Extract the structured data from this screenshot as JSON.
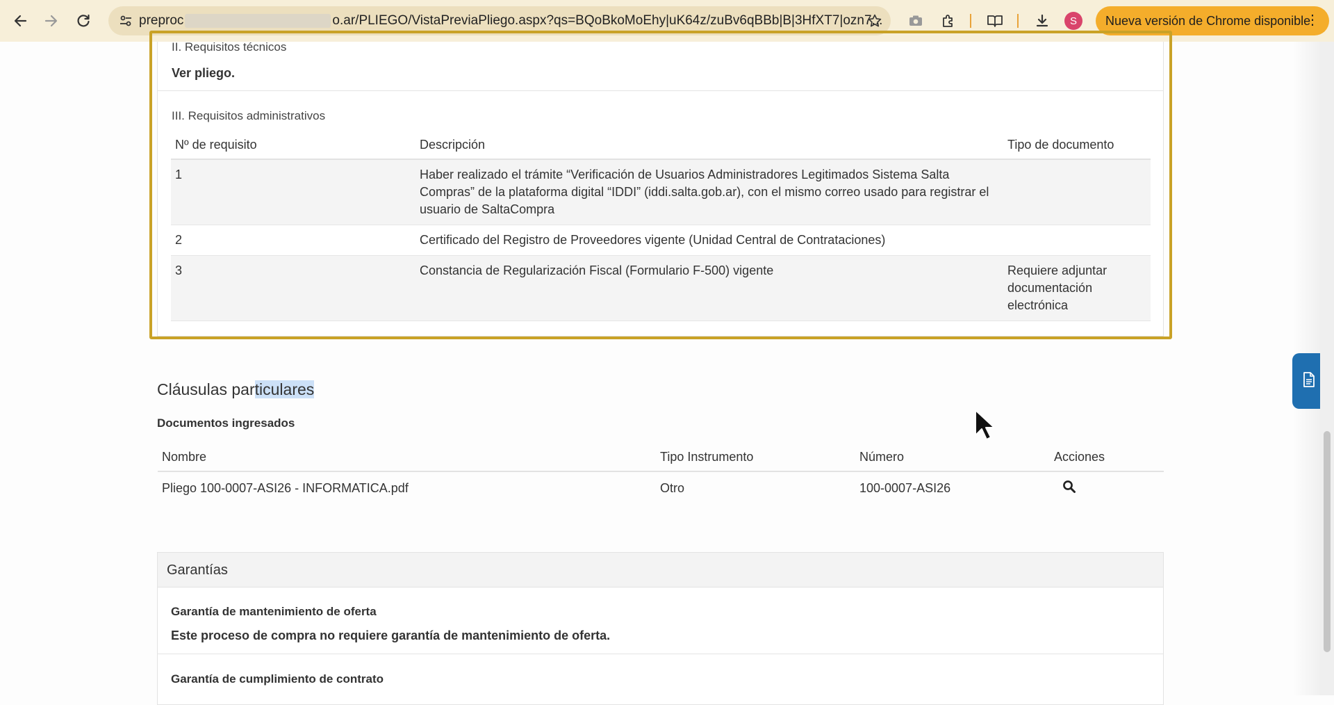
{
  "browser": {
    "url_start": "preproc",
    "url_end": "o.ar/PLIEGO/VistaPreviaPliego.aspx?qs=BQoBkoMoEhy|uK64z/zuBv6qBBb|B|3HfXT7|ozn7...",
    "avatar_initial": "S",
    "update_label": "Nueva versión de Chrome disponible",
    "accent_color": "#f4ad2b"
  },
  "tecnicos": {
    "heading": "II. Requisitos técnicos",
    "value": "Ver pliego."
  },
  "administrativos": {
    "heading": "III. Requisitos administrativos",
    "columns": [
      "Nº de requisito",
      "Descripción",
      "Tipo de documento"
    ],
    "rows": [
      {
        "num": "1",
        "desc": "Haber realizado el trámite “Verificación de Usuarios Administradores Legitimados Sistema Salta Compras” de la plataforma digital “IDDI” (iddi.salta.gob.ar), con el mismo correo usado para registrar el usuario de SaltaCompra",
        "tipo": ""
      },
      {
        "num": "2",
        "desc": "Certificado del Registro de Proveedores vigente (Unidad Central de Contrataciones)",
        "tipo": ""
      },
      {
        "num": "3",
        "desc": "Constancia de Regularización Fiscal (Formulario F-500) vigente",
        "tipo": "Requiere adjuntar documentación electrónica"
      }
    ]
  },
  "clausulas": {
    "heading_part1": "Cláusulas par",
    "heading_part2": "ticulares",
    "documentos_label": "Documentos ingresados",
    "columns": [
      "Nombre",
      "Tipo Instrumento",
      "Número",
      "Acciones"
    ],
    "rows": [
      {
        "nombre": "Pliego 100-0007-ASI26 - INFORMATICA.pdf",
        "tipo": "Otro",
        "numero": "100-0007-ASI26"
      }
    ]
  },
  "garantias": {
    "heading": "Garantías",
    "mantenimiento_label": "Garantía de mantenimiento de oferta",
    "mantenimiento_value": "Este proceso de compra no requiere garantía de mantenimiento de oferta.",
    "cumplimiento_label": "Garantía de cumplimiento de contrato"
  },
  "icons": [
    "back-arrow-icon",
    "forward-arrow-icon",
    "reload-icon",
    "site-settings-icon",
    "bookmark-star-icon",
    "camera-icon",
    "extensions-icon",
    "reading-mode-icon",
    "download-icon",
    "more-vert-icon",
    "search-icon",
    "document-icon",
    "cursor-icon"
  ]
}
